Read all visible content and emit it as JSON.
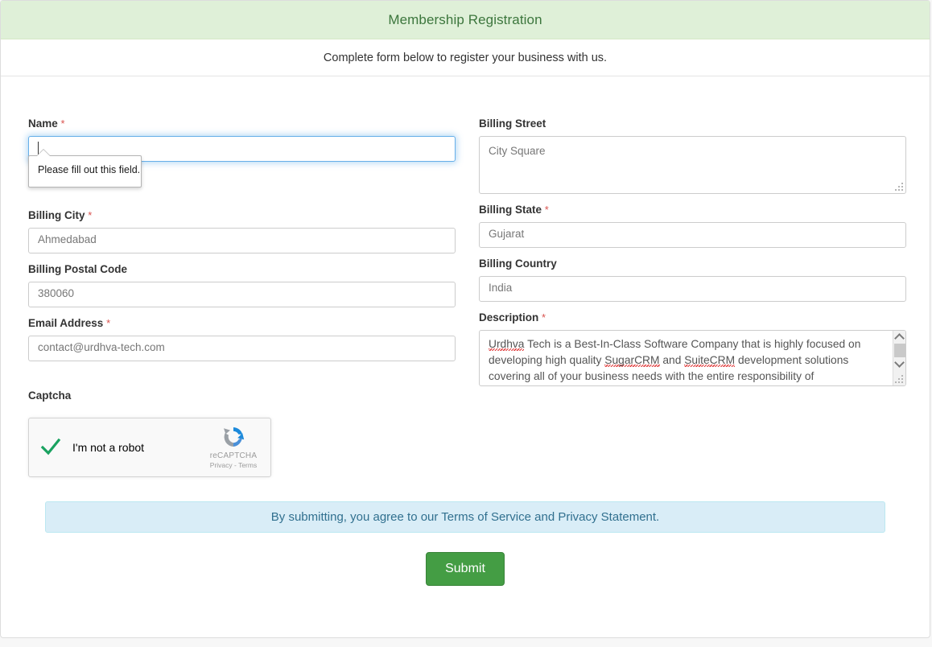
{
  "header": {
    "title": "Membership Registration",
    "subtitle": "Complete form below to register your business with us.",
    "bg_color": "#dff0d8",
    "title_color": "#3c763d"
  },
  "form": {
    "left_column": [
      {
        "name": "name",
        "label": "Name",
        "required": true,
        "required_marker": "*",
        "value": "",
        "type": "text",
        "focused": true,
        "validation_message": "Please fill out this field."
      },
      {
        "name": "billing_city",
        "label": "Billing City",
        "required": true,
        "required_marker": "*",
        "value": "Ahmedabad",
        "type": "text"
      },
      {
        "name": "billing_postal_code",
        "label": "Billing Postal Code",
        "required": false,
        "required_marker": "",
        "value": "380060",
        "type": "text"
      },
      {
        "name": "email_address",
        "label": "Email Address",
        "required": true,
        "required_marker": "*",
        "value": "contact@urdhva-tech.com",
        "type": "text"
      }
    ],
    "right_column": [
      {
        "name": "billing_street",
        "label": "Billing Street",
        "required": false,
        "required_marker": "",
        "value": "City Square",
        "type": "textarea"
      },
      {
        "name": "billing_state",
        "label": "Billing State",
        "required": true,
        "required_marker": "*",
        "value": "Gujarat",
        "type": "text"
      },
      {
        "name": "billing_country",
        "label": "Billing Country",
        "required": false,
        "required_marker": "",
        "value": "India",
        "type": "text"
      },
      {
        "name": "description",
        "label": "Description",
        "required": true,
        "required_marker": "*",
        "type": "textarea-scroll",
        "value_lines": [
          "Urdhva Tech is a Best-In-Class Software Company that is highly focused on",
          "developing high quality SugarCRM and SuiteCRM development solutions",
          "covering all of your business needs with the entire responsibility of"
        ],
        "misspelled": [
          "Urdhva",
          "SugarCRM",
          "SuiteCRM"
        ]
      }
    ]
  },
  "captcha": {
    "label": "Captcha",
    "checkbox_text": "I'm not a robot",
    "verified": true,
    "brand": "reCAPTCHA",
    "links": "Privacy - Terms"
  },
  "terms": {
    "text": "By submitting, you agree to our Terms of Service and Privacy Statement.",
    "bg_color": "#d9edf7",
    "text_color": "#31708f"
  },
  "submit": {
    "label": "Submit",
    "color": "#449d44"
  }
}
